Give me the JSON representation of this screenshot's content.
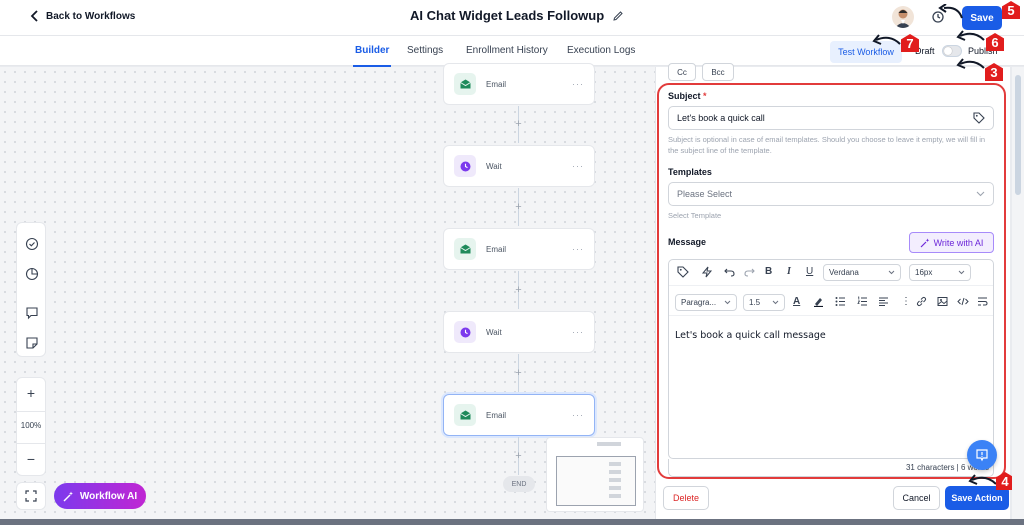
{
  "header": {
    "back_label": "Back to Workflows",
    "title": "AI Chat Widget Leads Followup",
    "save_label": "Save"
  },
  "tabs": [
    {
      "label": "Builder",
      "active": true
    },
    {
      "label": "Settings",
      "active": false
    },
    {
      "label": "Enrollment History",
      "active": false
    },
    {
      "label": "Execution Logs",
      "active": false
    }
  ],
  "actions": {
    "test_workflow_label": "Test Workflow",
    "draft_label": "Draft",
    "publish_label": "Publish",
    "publish_on": false
  },
  "canvas": {
    "nodes": [
      {
        "type": "email",
        "label": "Email"
      },
      {
        "type": "wait",
        "label": "Wait"
      },
      {
        "type": "email",
        "label": "Email"
      },
      {
        "type": "wait",
        "label": "Wait"
      },
      {
        "type": "email",
        "label": "Email",
        "selected": true
      }
    ],
    "end_label": "END",
    "zoom": "100%",
    "workflow_ai_label": "Workflow AI"
  },
  "panel": {
    "cc_label": "Cc",
    "bcc_label": "Bcc",
    "subject_label": "Subject",
    "subject_required_mark": "*",
    "subject_value": "Let's book a quick call",
    "subject_help": "Subject is optional in case of email templates. Should you choose to leave it empty, we will fill in the subject line of the template.",
    "templates_label": "Templates",
    "templates_placeholder": "Please Select",
    "templates_help": "Select Template",
    "message_label": "Message",
    "write_ai_label": "Write with AI",
    "font_family": "Verdana",
    "font_size": "16px",
    "paragraph": "Paragra...",
    "line_height": "1.5",
    "message_body": "Let's book a quick call message",
    "counter": "31 characters | 6 words",
    "delete_label": "Delete",
    "cancel_label": "Cancel",
    "save_action_label": "Save Action"
  },
  "annotations": [
    "5",
    "7",
    "6",
    "3",
    "4"
  ],
  "colors": {
    "primary": "#1a5ce6",
    "annotation": "#e11d1d",
    "ai_purple": "#7c3aed",
    "email_green": "#1f8a5b",
    "wait_purple": "#7c3aed"
  }
}
